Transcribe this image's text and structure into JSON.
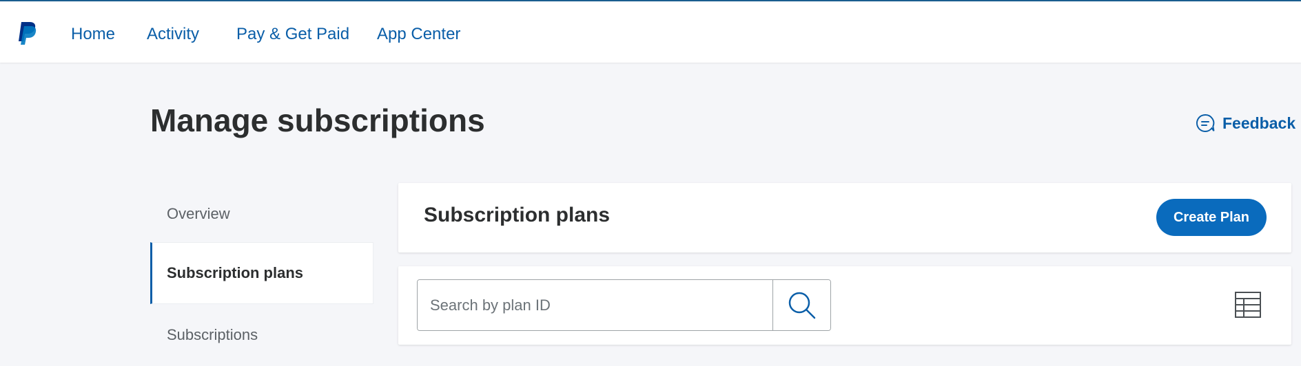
{
  "nav": {
    "logo": "paypal-logo",
    "items": [
      {
        "label": "Home"
      },
      {
        "label": "Activity"
      },
      {
        "label": "Pay & Get Paid"
      },
      {
        "label": "App Center"
      }
    ]
  },
  "page": {
    "title": "Manage subscriptions",
    "feedback_label": "Feedback",
    "feedback_icon": "chat-bubble-icon"
  },
  "sidebar": {
    "items": [
      {
        "label": "Overview",
        "active": false
      },
      {
        "label": "Subscription plans",
        "active": true
      },
      {
        "label": "Subscriptions",
        "active": false
      }
    ]
  },
  "plans_card": {
    "title": "Subscription plans",
    "create_label": "Create Plan"
  },
  "search": {
    "placeholder": "Search by plan ID",
    "value": "",
    "button_icon": "search-icon",
    "view_toggle_icon": "table-grid-icon"
  },
  "colors": {
    "brand_blue": "#0a5ea8",
    "button_blue": "#0a6bbd",
    "page_bg": "#f5f6f9",
    "text_dark": "#2c2e2f",
    "text_muted": "#5c6166"
  }
}
